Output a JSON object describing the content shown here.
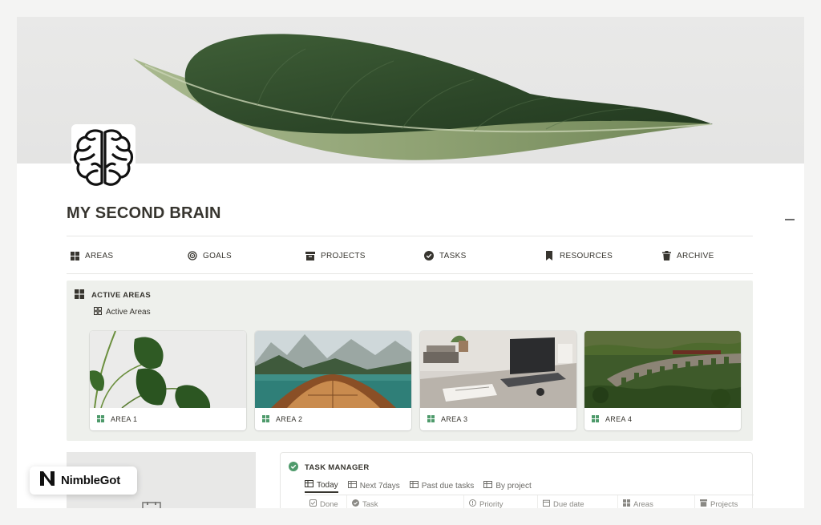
{
  "page": {
    "title": "MY SECOND BRAIN",
    "icon": "brain-icon"
  },
  "nav": {
    "items": [
      {
        "label": "AREAS",
        "icon": "grid-icon"
      },
      {
        "label": "GOALS",
        "icon": "target-icon"
      },
      {
        "label": "PROJECTS",
        "icon": "archive-box-icon"
      },
      {
        "label": "TASKS",
        "icon": "check-circle-icon"
      },
      {
        "label": "RESOURCES",
        "icon": "bookmark-icon"
      },
      {
        "label": "ARCHIVE",
        "icon": "trash-icon"
      }
    ]
  },
  "active_areas": {
    "heading": "ACTIVE AREAS",
    "view_tab": "Active Areas",
    "cards": [
      {
        "label": "AREA 1",
        "image": "monstera-plant"
      },
      {
        "label": "AREA 2",
        "image": "boat-on-lake"
      },
      {
        "label": "AREA 3",
        "image": "desk-laptop"
      },
      {
        "label": "AREA 4",
        "image": "viaduct-train"
      }
    ]
  },
  "task_manager": {
    "heading": "TASK MANAGER",
    "tabs": [
      {
        "label": "Today",
        "active": true
      },
      {
        "label": "Next 7days",
        "active": false
      },
      {
        "label": "Past due tasks",
        "active": false
      },
      {
        "label": "By project",
        "active": false
      }
    ],
    "columns": [
      "Done",
      "Task",
      "Priority",
      "Due date",
      "Areas",
      "Projects"
    ]
  },
  "watermark": {
    "text": "NimbleGot"
  },
  "colors": {
    "text": "#37352f",
    "callout_bg": "#eef0ec",
    "accent_green": "#4e9a6b",
    "leaf_dark": "#2f4a2c"
  }
}
